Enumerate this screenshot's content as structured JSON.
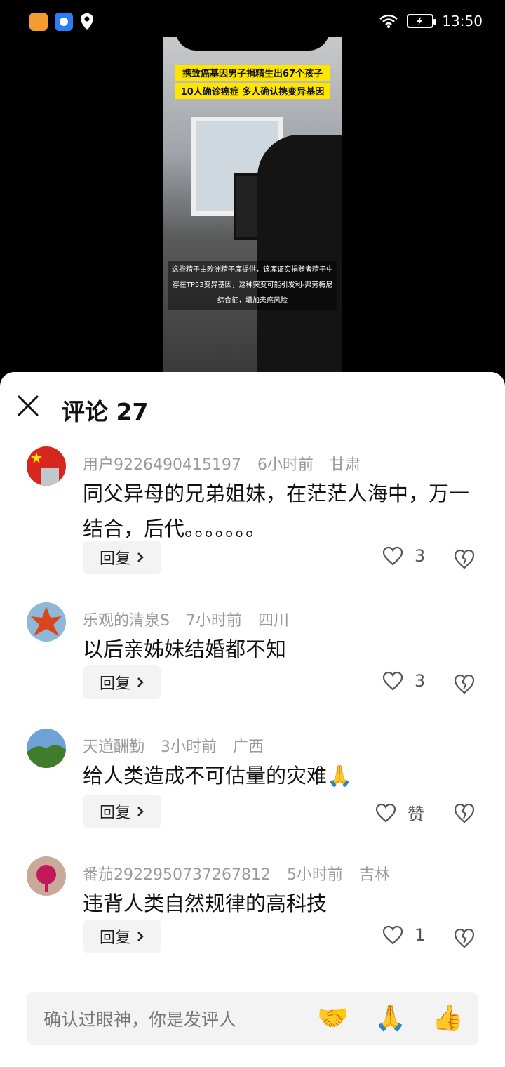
{
  "status_bar": {
    "time": "13:50"
  },
  "video": {
    "caption_line1": "携致癌基因男子捐精生出67个孩子",
    "caption_line2": "10人确诊癌症 多人确认携变异基因",
    "subtitle": "这些精子由欧洲精子库提供，该库证实捐赠者精子中存在TP53变异基因，这种突变可能引发利-弗劳梅尼综合征，增加患癌风险"
  },
  "sheet": {
    "title": "评论 27"
  },
  "comments": [
    {
      "user": "用户9226490415197",
      "time": "6小时前",
      "location": "甘肃",
      "text": "同父异母的兄弟姐妹，在茫茫人海中，万一结合，后代。。。。。。。",
      "reply_label": "回复",
      "likes": "3"
    },
    {
      "user": "乐观的清泉S",
      "time": "7小时前",
      "location": "四川",
      "text": "以后亲姊妹结婚都不知",
      "reply_label": "回复",
      "likes": "3"
    },
    {
      "user": "天道酬勤",
      "time": "3小时前",
      "location": "广西",
      "text": "给人类造成不可估量的灾难🙏",
      "reply_label": "回复",
      "likes": "赞"
    },
    {
      "user": "番茄2922950737267812",
      "time": "5小时前",
      "location": "吉林",
      "text": "违背人类自然规律的高科技",
      "reply_label": "回复",
      "likes": "1"
    }
  ],
  "input": {
    "placeholder": "确认过眼神，你是发评人",
    "emoji_1": "🤝",
    "emoji_2": "🙏",
    "emoji_3": "👍"
  }
}
